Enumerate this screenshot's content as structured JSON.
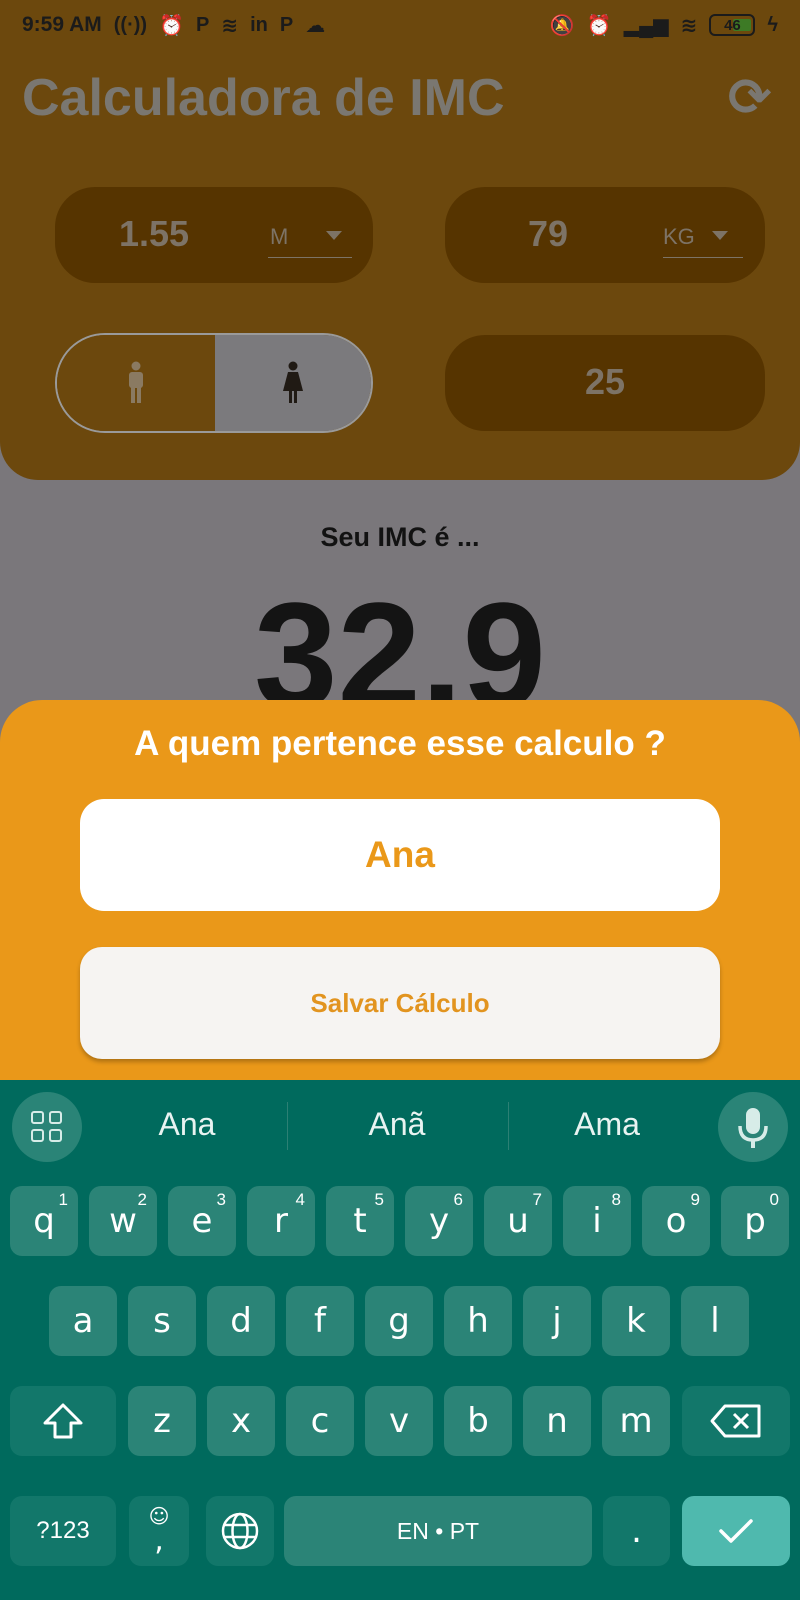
{
  "status_bar": {
    "time": "9:59 AM",
    "left_icons": [
      "radio-icon",
      "alarm-icon",
      "p-app-icon",
      "spotify-icon",
      "linkedin-icon",
      "p-app-icon",
      "cloud-icon"
    ],
    "right_icons": [
      "mute-icon",
      "alarm-icon",
      "signal-icon",
      "wifi-icon"
    ],
    "battery": "46"
  },
  "header": {
    "title": "Calculadora de IMC"
  },
  "height": {
    "value": "1.55",
    "unit": "M"
  },
  "weight": {
    "value": "79",
    "unit": "KG"
  },
  "age": {
    "value": "25"
  },
  "gender": {
    "selected": "female"
  },
  "result": {
    "label": "Seu IMC é ...",
    "value": "32.9"
  },
  "sheet": {
    "title": "A quem pertence esse calculo ?",
    "name_value": "Ana",
    "save_label": "Salvar Cálculo"
  },
  "keyboard": {
    "suggestions": [
      "Ana",
      "Anã",
      "Ama"
    ],
    "row1": [
      {
        "k": "q",
        "n": "1"
      },
      {
        "k": "w",
        "n": "2"
      },
      {
        "k": "e",
        "n": "3"
      },
      {
        "k": "r",
        "n": "4"
      },
      {
        "k": "t",
        "n": "5"
      },
      {
        "k": "y",
        "n": "6"
      },
      {
        "k": "u",
        "n": "7"
      },
      {
        "k": "i",
        "n": "8"
      },
      {
        "k": "o",
        "n": "9"
      },
      {
        "k": "p",
        "n": "0"
      }
    ],
    "row2": [
      "a",
      "s",
      "d",
      "f",
      "g",
      "h",
      "j",
      "k",
      "l"
    ],
    "row3": [
      "z",
      "x",
      "c",
      "v",
      "b",
      "n",
      "m"
    ],
    "symbols_label": "?123",
    "emoji_comma_label": ",",
    "space_label": "EN • PT",
    "period_label": ".",
    "accent_color": "#006a5d"
  },
  "colors": {
    "sheet_bg": "#ea9819",
    "accent_text": "#ea9819"
  }
}
